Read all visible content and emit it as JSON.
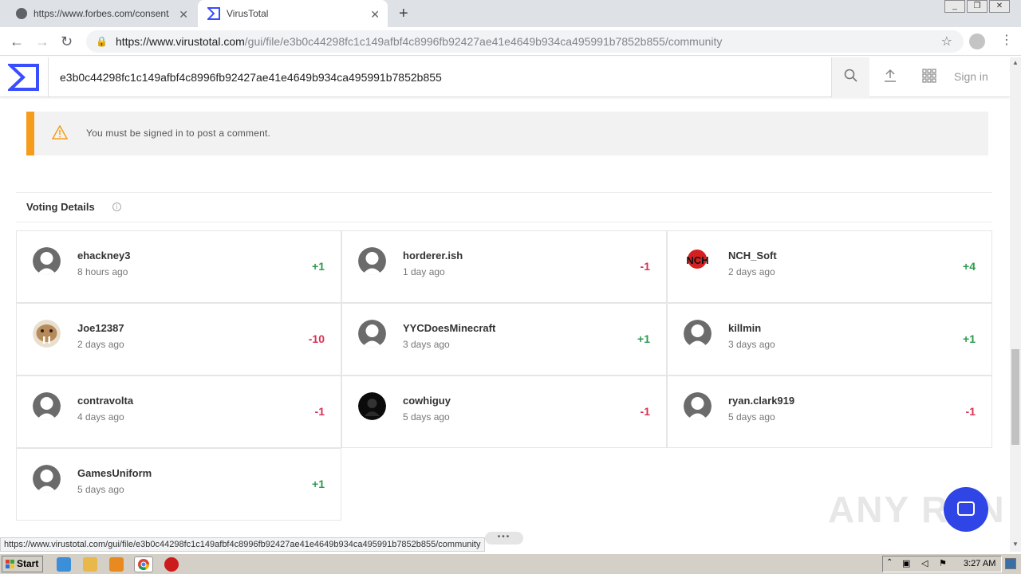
{
  "browser": {
    "tabs": [
      {
        "title": "https://www.forbes.com/consent/?t"
      },
      {
        "title": "VirusTotal"
      }
    ],
    "url_host": "https://www.virustotal.com",
    "url_path": "/gui/file/e3b0c44298fc1c149afbf4c8996fb92427ae41e4649b934ca495991b7852b855/community"
  },
  "vt": {
    "search_value": "e3b0c44298fc1c149afbf4c8996fb92427ae41e4649b934ca495991b7852b855",
    "signin_label": "Sign in"
  },
  "warning": {
    "message": "You must be signed in to post a comment."
  },
  "voting": {
    "title": "Voting Details",
    "info_icon": "i",
    "entries": [
      {
        "user": "ehackney3",
        "time": "8 hours ago",
        "vote": "+1",
        "avatar": "default"
      },
      {
        "user": "horderer.ish",
        "time": "1 day ago",
        "vote": "-1",
        "avatar": "default"
      },
      {
        "user": "NCH_Soft",
        "time": "2 days ago",
        "vote": "+4",
        "avatar": "nch"
      },
      {
        "user": "Joe12387",
        "time": "2 days ago",
        "vote": "-10",
        "avatar": "walrus"
      },
      {
        "user": "YYCDoesMinecraft",
        "time": "3 days ago",
        "vote": "+1",
        "avatar": "default"
      },
      {
        "user": "killmin",
        "time": "3 days ago",
        "vote": "+1",
        "avatar": "default"
      },
      {
        "user": "contravolta",
        "time": "4 days ago",
        "vote": "-1",
        "avatar": "default"
      },
      {
        "user": "cowhiguy",
        "time": "5 days ago",
        "vote": "-1",
        "avatar": "dark"
      },
      {
        "user": "ryan.clark919",
        "time": "5 days ago",
        "vote": "-1",
        "avatar": "default"
      },
      {
        "user": "GamesUniform",
        "time": "5 days ago",
        "vote": "+1",
        "avatar": "default"
      }
    ]
  },
  "status_url": "https://www.virustotal.com/gui/file/e3b0c44298fc1c149afbf4c8996fb92427ae41e4649b934ca495991b7852b855/community",
  "taskbar": {
    "start_label": "Start",
    "clock": "3:27 AM"
  },
  "watermark": "ANY RUN",
  "colors": {
    "accent": "#394eff",
    "warning": "#f59c1a",
    "positive": "#2e9b4e",
    "negative": "#d83154"
  }
}
